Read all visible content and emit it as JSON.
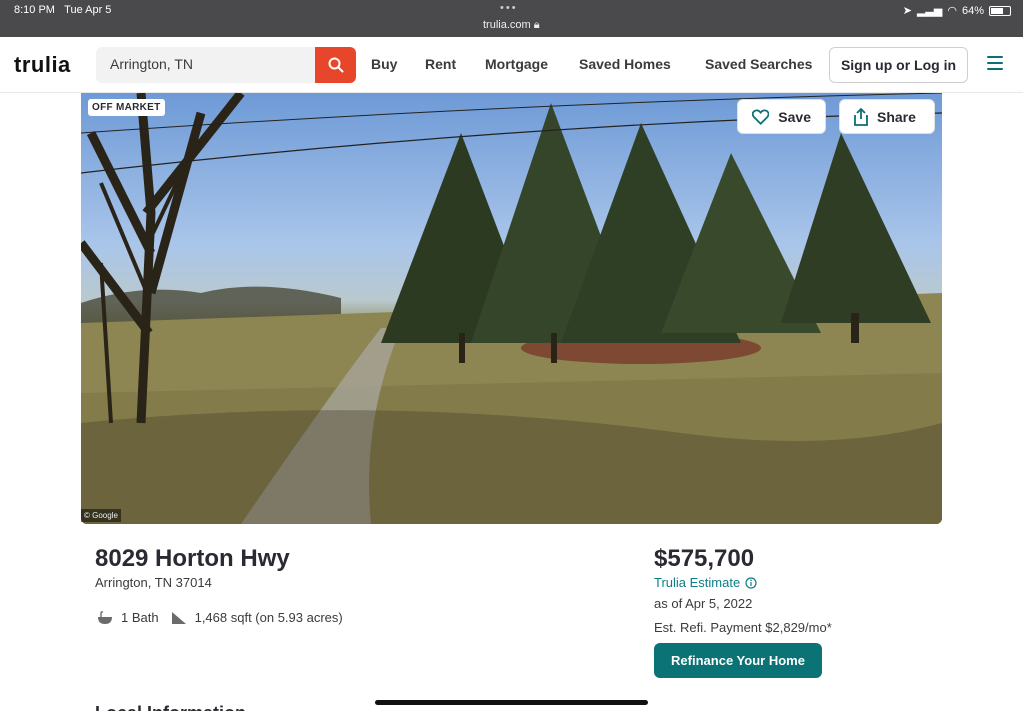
{
  "status_bar": {
    "time": "8:10 PM",
    "date": "Tue Apr 5",
    "url": "trulia.com",
    "battery": "64%"
  },
  "header": {
    "logo": "trulia",
    "search_value": "Arrington, TN",
    "nav": {
      "buy": "Buy",
      "rent": "Rent",
      "mortgage": "Mortgage",
      "saved_homes": "Saved Homes",
      "saved_searches": "Saved Searches"
    },
    "login": "Sign up or Log in"
  },
  "hero": {
    "badge": "OFF MARKET",
    "save": "Save",
    "share": "Share",
    "copyright": "© Google"
  },
  "property": {
    "address": "8029 Horton Hwy",
    "city_state_zip": "Arrington, TN 37014",
    "baths": "1 Bath",
    "size": "1,468 sqft (on 5.93 acres)",
    "price": "$575,700",
    "estimate_label": "Trulia Estimate",
    "as_of": "as of Apr 5, 2022",
    "refi_payment": "Est. Refi. Payment $2,829/mo*",
    "refi_button": "Refinance Your Home",
    "next_section": "Local Information"
  },
  "colors": {
    "accent_teal": "#0b7276",
    "search_red": "#e8462a"
  }
}
